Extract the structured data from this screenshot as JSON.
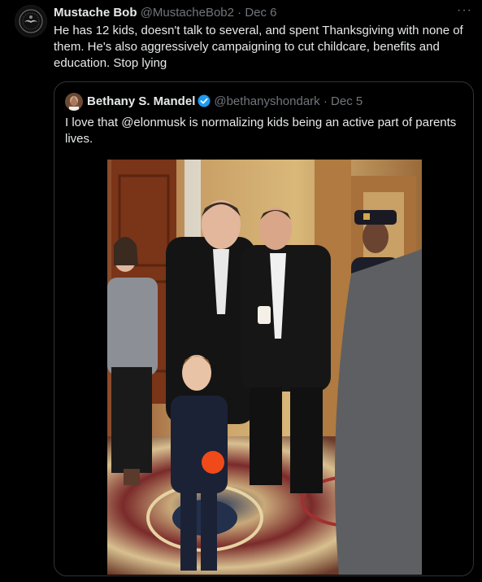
{
  "tweet": {
    "display_name": "Mustache Bob",
    "handle": "@MustacheBob2",
    "separator": "·",
    "date": "Dec 6",
    "more_icon": "more-horizontal-icon",
    "text": "He has 12 kids, doesn't talk to several, and spent Thanksgiving with none of them.  He's also aggressively campaigning to cut childcare, benefits and education. Stop lying"
  },
  "quote": {
    "display_name": "Bethany S. Mandel",
    "verified_icon": "verified-badge-icon",
    "handle": "@bethanyshondark",
    "separator": "·",
    "date": "Dec 5",
    "text": "I love that @elonmusk is normalizing kids being an active part of parents lives."
  },
  "colors": {
    "background": "#000000",
    "text": "#e7e9ea",
    "muted": "#71767b",
    "border": "#2f3336",
    "verified": "#1d9bf0"
  }
}
